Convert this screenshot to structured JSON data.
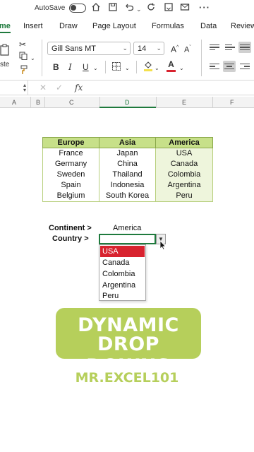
{
  "titlebar": {
    "autosave_label": "AutoSave",
    "icons": [
      "toggle-off-icon",
      "home-icon",
      "save-icon",
      "undo-icon",
      "redo-icon",
      "refresh-icon",
      "mail-icon",
      "more-icon"
    ]
  },
  "tabs": [
    {
      "label": "me",
      "active": true
    },
    {
      "label": "Insert"
    },
    {
      "label": "Draw"
    },
    {
      "label": "Page Layout"
    },
    {
      "label": "Formulas"
    },
    {
      "label": "Data"
    },
    {
      "label": "Review"
    }
  ],
  "ribbon": {
    "paste_label": "ste",
    "font_name": "Gill Sans MT",
    "font_size": "14",
    "grow_font": "A",
    "shrink_font": "A",
    "bold": "B",
    "italic": "I",
    "underline": "U",
    "font_color_letter": "A",
    "accent_color": "#1f7a3d",
    "font_color_bar": "#d8232f",
    "highlight_color_bar": "#f4e04d"
  },
  "formula_bar": {
    "fx_label": "fx"
  },
  "columns": [
    "A",
    "B",
    "C",
    "D",
    "E",
    "F"
  ],
  "table": {
    "headers": [
      "Europe",
      "Asia",
      "America"
    ],
    "europe": [
      "France",
      "Germany",
      "Sweden",
      "Spain",
      "Belgium"
    ],
    "asia": [
      "Japan",
      "China",
      "Thailand",
      "Indonesia",
      "South Korea"
    ],
    "america": [
      "USA",
      "Canada",
      "Colombia",
      "Argentina",
      "Peru"
    ],
    "header_color": "#c7e089"
  },
  "selectors": {
    "continent_label": "Continent >",
    "continent_value": "America",
    "country_label": "Country >",
    "country_value": ""
  },
  "dropdown": {
    "options": [
      "USA",
      "Canada",
      "Colombia",
      "Argentina",
      "Peru"
    ],
    "highlighted": "USA",
    "highlight_color": "#d8232f"
  },
  "banner": {
    "line1": "DYNAMIC",
    "line2": "DROP DOWNS",
    "color": "#b6cf5b"
  },
  "brand": "MR.EXCEL101"
}
